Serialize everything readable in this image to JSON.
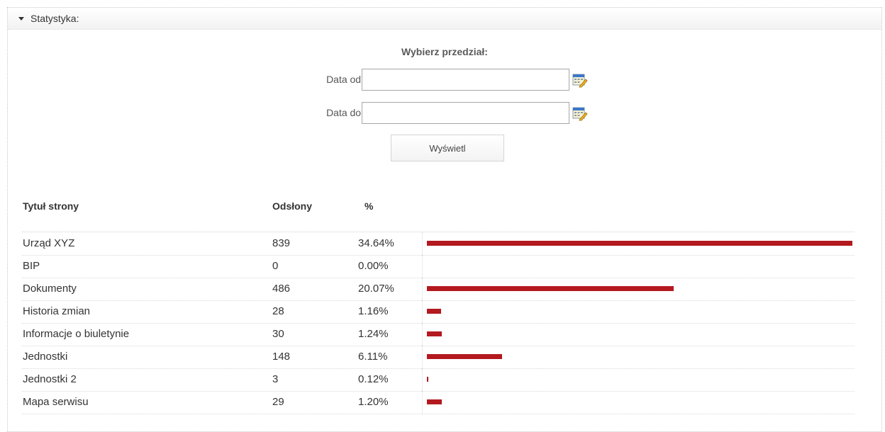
{
  "panel": {
    "title": "Statystyka:"
  },
  "form": {
    "heading": "Wybierz przedział:",
    "date_from_label": "Data od:",
    "date_to_label": "Data do:",
    "date_from_value": "",
    "date_to_value": "",
    "button_label": "Wyświetl"
  },
  "table": {
    "headers": {
      "title": "Tytuł strony",
      "views": "Odsłony",
      "percent": "%"
    },
    "rows": [
      {
        "title": "Urząd XYZ",
        "views": "839",
        "percent": "34.64%",
        "share": 0.3464
      },
      {
        "title": "BIP",
        "views": "0",
        "percent": "0.00%",
        "share": 0
      },
      {
        "title": "Dokumenty",
        "views": "486",
        "percent": "20.07%",
        "share": 0.2007
      },
      {
        "title": "Historia zmian",
        "views": "28",
        "percent": "1.16%",
        "share": 0.0116
      },
      {
        "title": "Informacje o biuletynie",
        "views": "30",
        "percent": "1.24%",
        "share": 0.0124
      },
      {
        "title": "Jednostki",
        "views": "148",
        "percent": "6.11%",
        "share": 0.0611
      },
      {
        "title": "Jednostki 2",
        "views": "3",
        "percent": "0.12%",
        "share": 0.0012
      },
      {
        "title": "Mapa serwisu",
        "views": "29",
        "percent": "1.20%",
        "share": 0.012
      }
    ]
  },
  "colors": {
    "bar": "#b3191e"
  }
}
